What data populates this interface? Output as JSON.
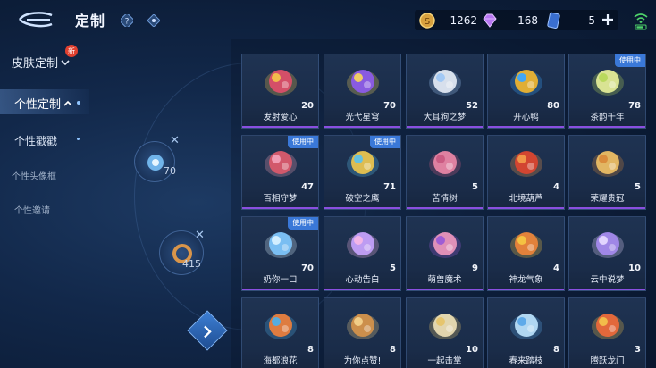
{
  "header": {
    "title": "定制"
  },
  "currencies": {
    "gold": "1262",
    "gems": "168",
    "tickets": "5"
  },
  "nav": {
    "skin_custom": "皮肤定制",
    "new_badge": "新",
    "personal_custom": "个性定制",
    "personal_stamp": "个性戳戳",
    "avatar_frame": "个性头像框",
    "invite": "个性邀请"
  },
  "floating": {
    "item1_count": "70",
    "item2_count": "415"
  },
  "colors": {
    "accent_purple": "#8a4fe0",
    "badge_blue": "#3a78d8",
    "new_red": "#e0402f"
  },
  "in_use_label": "使用中",
  "items": [
    {
      "name": "发射爱心",
      "count": "20",
      "in_use": false,
      "icon": "heart-launcher-icon",
      "c1": "#e24f6b",
      "c2": "#f2c14b"
    },
    {
      "name": "光弋星穹",
      "count": "70",
      "in_use": false,
      "icon": "starry-crown-icon",
      "c1": "#8f5bf0",
      "c2": "#f4d35e"
    },
    {
      "name": "大耳狗之梦",
      "count": "52",
      "in_use": false,
      "icon": "cinnamoroll-icon",
      "c1": "#e8eef8",
      "c2": "#9fc7f5"
    },
    {
      "name": "开心鸭",
      "count": "80",
      "in_use": false,
      "icon": "happy-duck-icon",
      "c1": "#f5b82e",
      "c2": "#3aa7ff"
    },
    {
      "name": "茶韵千年",
      "count": "78",
      "in_use": true,
      "icon": "tea-flower-icon",
      "c1": "#e9f29a",
      "c2": "#b7d85a"
    },
    {
      "name": "百相守梦",
      "count": "47",
      "in_use": true,
      "icon": "dream-chest-icon",
      "c1": "#e05a6b",
      "c2": "#f2a0b8"
    },
    {
      "name": "破空之鹰",
      "count": "71",
      "in_use": true,
      "icon": "sky-eagle-icon",
      "c1": "#f2c94c",
      "c2": "#5fc2e8"
    },
    {
      "name": "苦情树",
      "count": "5",
      "in_use": false,
      "icon": "bitter-tree-icon",
      "c1": "#f08aa8",
      "c2": "#c95a82"
    },
    {
      "name": "北境葫芦",
      "count": "4",
      "in_use": false,
      "icon": "gourd-icon",
      "c1": "#e0452f",
      "c2": "#f29a4a"
    },
    {
      "name": "荣耀贵冠",
      "count": "5",
      "in_use": false,
      "icon": "glory-crown-icon",
      "c1": "#f2c266",
      "c2": "#d98a3a"
    },
    {
      "name": "奶你一口",
      "count": "70",
      "in_use": true,
      "icon": "ice-crystal-icon",
      "c1": "#7ec8ff",
      "c2": "#d7f0ff"
    },
    {
      "name": "心动告白",
      "count": "5",
      "in_use": false,
      "icon": "crystal-heart-icon",
      "c1": "#c9a4ff",
      "c2": "#f4b6e6"
    },
    {
      "name": "萌兽魔术",
      "count": "9",
      "in_use": false,
      "icon": "magic-bunny-icon",
      "c1": "#f29ac0",
      "c2": "#9b5bd6"
    },
    {
      "name": "神龙气象",
      "count": "4",
      "in_use": false,
      "icon": "dragon-flame-icon",
      "c1": "#f2863a",
      "c2": "#f4c542"
    },
    {
      "name": "云中说梦",
      "count": "10",
      "in_use": false,
      "icon": "cloud-dream-icon",
      "c1": "#a88cf2",
      "c2": "#e6d8ff"
    },
    {
      "name": "海都浪花",
      "count": "8",
      "in_use": false,
      "icon": "starfish-icon",
      "c1": "#f2813a",
      "c2": "#4fb0e8"
    },
    {
      "name": "为你点赞!",
      "count": "8",
      "in_use": false,
      "icon": "bell-icon",
      "c1": "#d9954a",
      "c2": "#f2d18a"
    },
    {
      "name": "一起击掌",
      "count": "10",
      "in_use": false,
      "icon": "high-five-icon",
      "c1": "#f2e3b8",
      "c2": "#e6c46a"
    },
    {
      "name": "春来踏枝",
      "count": "8",
      "in_use": false,
      "icon": "swallow-icon",
      "c1": "#bfe6ff",
      "c2": "#5aa8e8"
    },
    {
      "name": "腾跃龙门",
      "count": "3",
      "in_use": false,
      "icon": "koi-icon",
      "c1": "#f26a3a",
      "c2": "#f2c14b"
    }
  ]
}
